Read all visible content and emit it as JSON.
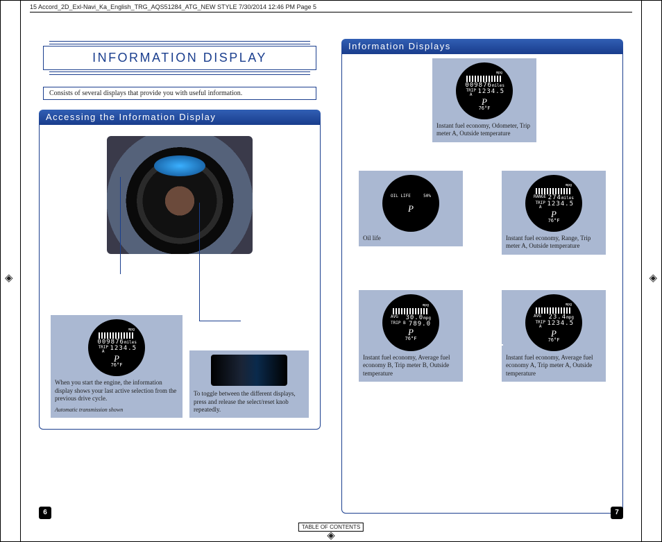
{
  "slug": "15 Accord_2D_Exl-Navi_Ka_English_TRG_AQS51284_ATG_NEW STYLE  7/30/2014  12:46 PM  Page 5",
  "main_heading": "INFORMATION DISPLAY",
  "intro": "Consists of several displays that provide you with useful information.",
  "left": {
    "title": "Accessing the Information Display",
    "callout_start": "When you start the engine, the information display shows your last active selection from the previous drive cycle.",
    "footnote": "Automatic transmission shown",
    "callout_toggle": "To toggle between the different displays, press and release the select/reset knob repeatedly.",
    "gauge": {
      "mpg": "mpg",
      "odo_lbl": "",
      "odo": "009876",
      "odo_unit": "miles",
      "trip_lbl": "TRIP A",
      "trip": "1234.5",
      "gear": "P",
      "temp": "76°F"
    }
  },
  "right": {
    "title": "Information Displays",
    "d1": {
      "caption": "Instant fuel economy, Odometer, Trip meter A, Outside temperature",
      "gauge": {
        "mpg": "mpg",
        "odo": "009876",
        "odo_unit": "miles",
        "trip_lbl": "TRIP A",
        "trip": "1234.5",
        "gear": "P",
        "temp": "76°F"
      }
    },
    "d2": {
      "caption": "Oil life",
      "gauge": {
        "label": "OIL LIFE",
        "value": "50%",
        "gear": "P"
      }
    },
    "d3": {
      "caption": "Instant fuel economy, Range, Trip meter A, Outside temperature",
      "gauge": {
        "mpg": "mpg",
        "range_lbl": "RANGE",
        "range": "274",
        "range_unit": "miles",
        "trip_lbl": "TRIP A",
        "trip": "1234.5",
        "gear": "P",
        "temp": "76°F"
      }
    },
    "d4": {
      "caption": "Instant fuel economy, Average fuel economy B, Trip meter B, Outside temperature",
      "gauge": {
        "mpg": "mpg",
        "avg_lbl": "AVG",
        "avg": "30.0",
        "avg_unit": "mpg",
        "trip_lbl": "TRIP B",
        "trip": "789.0",
        "gear": "P",
        "temp": "76°F"
      }
    },
    "d5": {
      "caption": "Instant fuel economy, Average fuel economy A, Trip meter A, Outside temperature",
      "gauge": {
        "mpg": "mpg",
        "avg_lbl": "AVG",
        "avg": "23.4",
        "avg_unit": "mpg",
        "trip_lbl": "TRIP A",
        "trip": "1234.5",
        "gear": "P",
        "temp": "76°F"
      }
    }
  },
  "page_left": "6",
  "page_right": "7",
  "toc": "TABLE OF CONTENTS",
  "regmark": "◈"
}
